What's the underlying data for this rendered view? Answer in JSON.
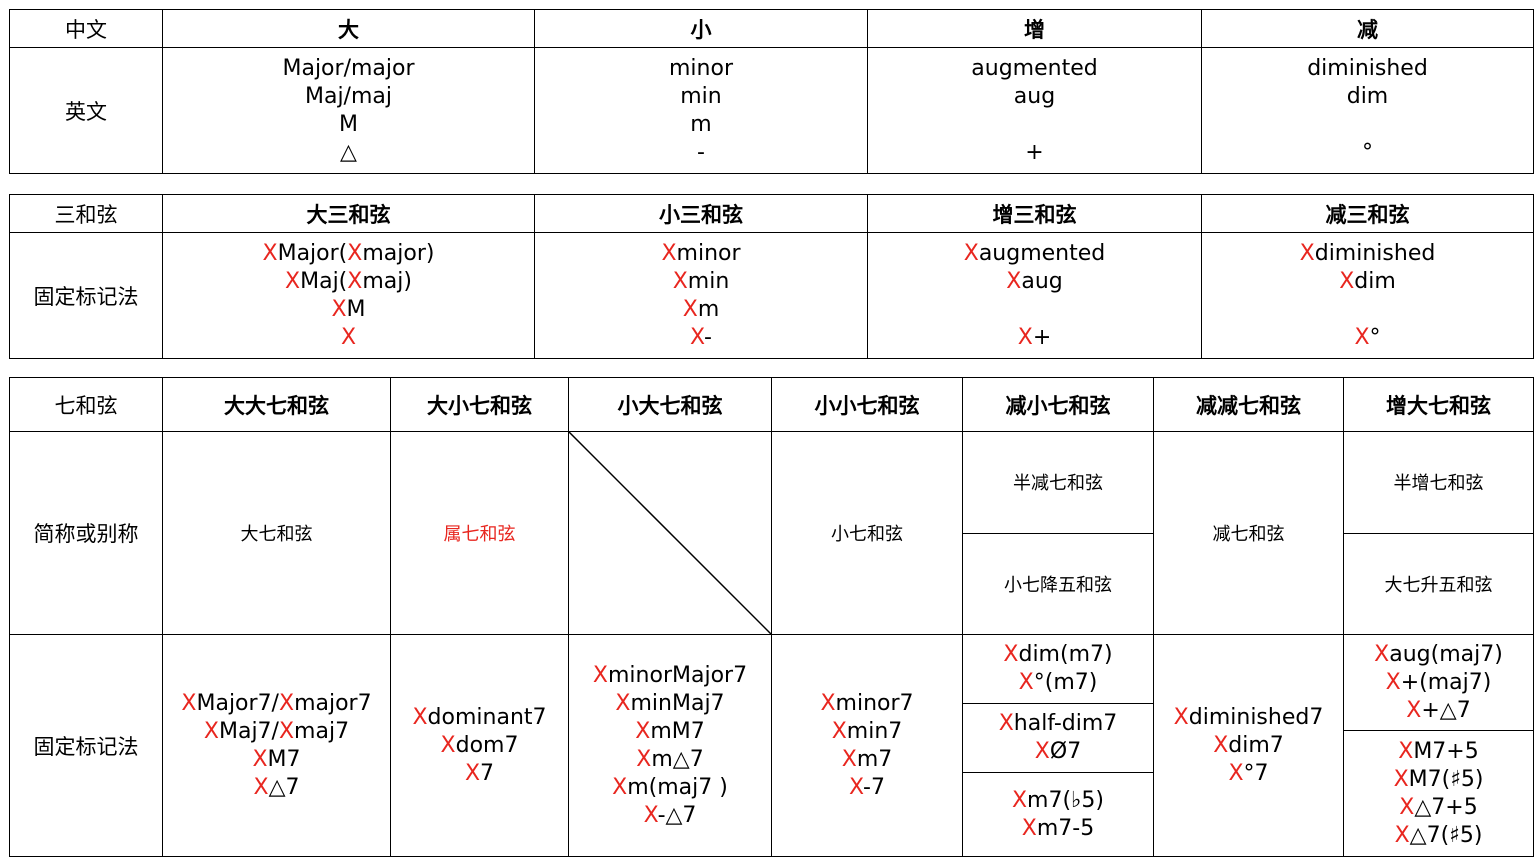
{
  "t1": {
    "row_header": "中文",
    "headers": [
      "大",
      "小",
      "增",
      "减"
    ],
    "row2_label": "英文",
    "cells": [
      [
        "Major/major",
        "Maj/maj",
        "M",
        "△"
      ],
      [
        "minor",
        "min",
        "m",
        "-"
      ],
      [
        "augmented",
        "aug",
        "",
        "+"
      ],
      [
        "diminished",
        "dim",
        "",
        "°"
      ]
    ]
  },
  "t2": {
    "row_header": "三和弦",
    "headers": [
      "大三和弦",
      "小三和弦",
      "增三和弦",
      "减三和弦"
    ],
    "row2_label": "固定标记法",
    "cells": [
      [
        [
          [
            "X",
            "r"
          ],
          [
            "Major(",
            ""
          ],
          [
            "X",
            "r"
          ],
          [
            "major)",
            ""
          ]
        ],
        [
          [
            "X",
            "r"
          ],
          [
            "Maj(",
            ""
          ],
          [
            "X",
            "r"
          ],
          [
            "maj)",
            ""
          ]
        ],
        [
          [
            "X",
            "r"
          ],
          [
            "M",
            ""
          ]
        ],
        [
          [
            "X",
            "r"
          ]
        ]
      ],
      [
        [
          [
            "X",
            "r"
          ],
          [
            "minor",
            ""
          ]
        ],
        [
          [
            "X",
            "r"
          ],
          [
            "min",
            ""
          ]
        ],
        [
          [
            "X",
            "r"
          ],
          [
            "m",
            ""
          ]
        ],
        [
          [
            "X",
            "r"
          ],
          [
            "-",
            ""
          ]
        ]
      ],
      [
        [
          [
            "X",
            "r"
          ],
          [
            "augmented",
            ""
          ]
        ],
        [
          [
            "X",
            "r"
          ],
          [
            "aug",
            ""
          ]
        ],
        [],
        [
          [
            "X",
            "r"
          ],
          [
            "+",
            ""
          ]
        ]
      ],
      [
        [
          [
            "X",
            "r"
          ],
          [
            "diminished",
            ""
          ]
        ],
        [
          [
            "X",
            "r"
          ],
          [
            "dim",
            ""
          ]
        ],
        [],
        [
          [
            "X",
            "r"
          ],
          [
            "°",
            ""
          ]
        ]
      ]
    ]
  },
  "t3": {
    "row_header": "七和弦",
    "headers": [
      "大大七和弦",
      "大小七和弦",
      "小大七和弦",
      "小小七和弦",
      "减小七和弦",
      "减减七和弦",
      "增大七和弦"
    ],
    "alias_label": "简称或别称",
    "aliases": {
      "major_major": "大七和弦",
      "major_minor": "属七和弦",
      "minor_minor": "小七和弦",
      "half_dim_1": "半减七和弦",
      "half_dim_2": "小七降五和弦",
      "dim_dim": "减七和弦",
      "aug_major_1": "半增七和弦",
      "aug_major_2": "大七升五和弦"
    },
    "notation_label": "固定标记法",
    "notation": {
      "major_major": [
        [
          [
            "X",
            "r"
          ],
          [
            "Major7/",
            ""
          ],
          [
            "X",
            "r"
          ],
          [
            "major7",
            ""
          ]
        ],
        [
          [
            "X",
            "r"
          ],
          [
            "Maj7/",
            ""
          ],
          [
            "X",
            "r"
          ],
          [
            "maj7",
            ""
          ]
        ],
        [
          [
            "X",
            "r"
          ],
          [
            "M7",
            ""
          ]
        ],
        [
          [
            "X",
            "r"
          ],
          [
            "△7",
            ""
          ]
        ]
      ],
      "major_minor": [
        [
          [
            "X",
            "r"
          ],
          [
            "dominant7",
            ""
          ]
        ],
        [
          [
            "X",
            "r"
          ],
          [
            "dom7",
            ""
          ]
        ],
        [
          [
            "X",
            "r"
          ],
          [
            "7",
            ""
          ]
        ]
      ],
      "minor_major": [
        [
          [
            "X",
            "r"
          ],
          [
            "minorMajor7",
            ""
          ]
        ],
        [
          [
            "X",
            "r"
          ],
          [
            "minMaj7",
            ""
          ]
        ],
        [
          [
            "X",
            "r"
          ],
          [
            "mM7",
            ""
          ]
        ],
        [
          [
            "X",
            "r"
          ],
          [
            "m△7",
            ""
          ]
        ],
        [
          [
            "X",
            "r"
          ],
          [
            "m(maj7 )",
            ""
          ]
        ],
        [
          [
            "X",
            "r"
          ],
          [
            "-△7",
            ""
          ]
        ]
      ],
      "minor_minor": [
        [
          [
            "X",
            "r"
          ],
          [
            "minor7",
            ""
          ]
        ],
        [
          [
            "X",
            "r"
          ],
          [
            "min7",
            ""
          ]
        ],
        [
          [
            "X",
            "r"
          ],
          [
            "m7",
            ""
          ]
        ],
        [
          [
            "X",
            "r"
          ],
          [
            "-7",
            ""
          ]
        ]
      ],
      "half_dim_a": [
        [
          [
            "X",
            "r"
          ],
          [
            "dim(m7)",
            ""
          ]
        ],
        [
          [
            "X",
            "r"
          ],
          [
            "°(m7)",
            ""
          ]
        ]
      ],
      "half_dim_b": [
        [
          [
            "X",
            "r"
          ],
          [
            "half-dim7",
            ""
          ]
        ],
        [
          [
            "X",
            "r"
          ],
          [
            "Ø7",
            ""
          ]
        ]
      ],
      "half_dim_c": [
        [
          [
            "X",
            "r"
          ],
          [
            "m7(♭5)",
            ""
          ]
        ],
        [
          [
            "X",
            "r"
          ],
          [
            "m7-5",
            ""
          ]
        ]
      ],
      "dim_dim": [
        [
          [
            "X",
            "r"
          ],
          [
            "diminished7",
            ""
          ]
        ],
        [
          [
            "X",
            "r"
          ],
          [
            "dim7",
            ""
          ]
        ],
        [
          [
            "X",
            "r"
          ],
          [
            "°7",
            ""
          ]
        ]
      ],
      "aug_major_a": [
        [
          [
            "X",
            "r"
          ],
          [
            "aug(maj7)",
            ""
          ]
        ],
        [
          [
            "X",
            "r"
          ],
          [
            "+(maj7)",
            ""
          ]
        ],
        [
          [
            "X",
            "r"
          ],
          [
            "+△7",
            ""
          ]
        ]
      ],
      "aug_major_b": [
        [
          [
            "X",
            "r"
          ],
          [
            "M7+5",
            ""
          ]
        ],
        [
          [
            "X",
            "r"
          ],
          [
            "M7(♯5)",
            ""
          ]
        ],
        [
          [
            "X",
            "r"
          ],
          [
            "△7+5",
            ""
          ]
        ],
        [
          [
            "X",
            "r"
          ],
          [
            "△7(♯5)",
            ""
          ]
        ]
      ]
    }
  },
  "colors": {
    "accent_red": "#e8261f",
    "border": "#000000"
  }
}
